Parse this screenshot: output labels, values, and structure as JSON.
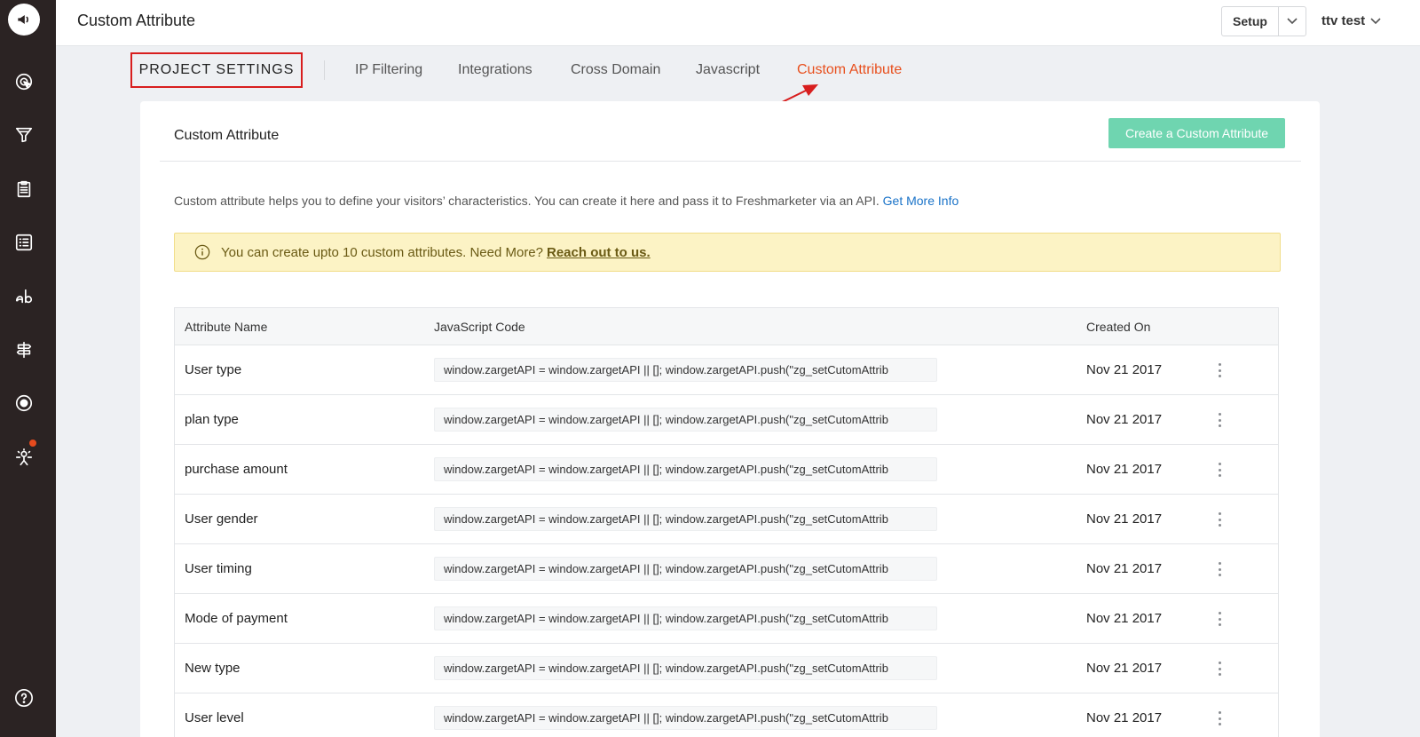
{
  "header": {
    "title": "Custom Attribute",
    "setup_label": "Setup",
    "user_name": "ttv test"
  },
  "tabs": {
    "section_label": "PROJECT SETTINGS",
    "items": [
      {
        "label": "IP Filtering"
      },
      {
        "label": "Integrations"
      },
      {
        "label": "Cross Domain"
      },
      {
        "label": "Javascript"
      },
      {
        "label": "Custom Attribute",
        "active": true
      }
    ]
  },
  "card": {
    "title": "Custom Attribute",
    "create_button": "Create a Custom Attribute",
    "description": "Custom attribute helps you to define your visitors’ characteristics. You can create it here and pass it to Freshmarketer via an API.",
    "description_link": "Get More Info",
    "notice_text": "You can create upto 10 custom attributes. Need More?",
    "notice_link": "Reach out to us."
  },
  "table": {
    "headers": [
      "Attribute Name",
      "JavaScript Code",
      "Created On"
    ],
    "rows": [
      {
        "name": "User type",
        "code": "window.zargetAPI = window.zargetAPI || []; window.zargetAPI.push(\"zg_setCutomAttrib",
        "date": "Nov 21 2017"
      },
      {
        "name": "plan type",
        "code": "window.zargetAPI = window.zargetAPI || []; window.zargetAPI.push(\"zg_setCutomAttrib",
        "date": "Nov 21 2017"
      },
      {
        "name": "purchase amount",
        "code": "window.zargetAPI = window.zargetAPI || []; window.zargetAPI.push(\"zg_setCutomAttrib",
        "date": "Nov 21 2017"
      },
      {
        "name": "User gender",
        "code": "window.zargetAPI = window.zargetAPI || []; window.zargetAPI.push(\"zg_setCutomAttrib",
        "date": "Nov 21 2017"
      },
      {
        "name": "User timing",
        "code": "window.zargetAPI = window.zargetAPI || []; window.zargetAPI.push(\"zg_setCutomAttrib",
        "date": "Nov 21 2017"
      },
      {
        "name": "Mode of payment",
        "code": "window.zargetAPI = window.zargetAPI || []; window.zargetAPI.push(\"zg_setCutomAttrib",
        "date": "Nov 21 2017"
      },
      {
        "name": "New type",
        "code": "window.zargetAPI = window.zargetAPI || []; window.zargetAPI.push(\"zg_setCutomAttrib",
        "date": "Nov 21 2017"
      },
      {
        "name": "User level",
        "code": "window.zargetAPI = window.zargetAPI || []; window.zargetAPI.push(\"zg_setCutomAttrib",
        "date": "Nov 21 2017"
      }
    ]
  },
  "colors": {
    "sidebar": "#2b2323",
    "accent": "#e8501e",
    "create_button": "#6fd5b0",
    "notice_bg": "#fcf3c5",
    "highlight_box": "#d81e1e"
  },
  "icons": [
    "megaphone-icon",
    "target-cursor-icon",
    "funnel-icon",
    "clipboard-icon",
    "list-icon",
    "ab-test-icon",
    "signpost-icon",
    "record-icon",
    "sun-person-icon",
    "help-icon",
    "chevron-down-icon",
    "info-icon",
    "kebab-menu-icon"
  ]
}
